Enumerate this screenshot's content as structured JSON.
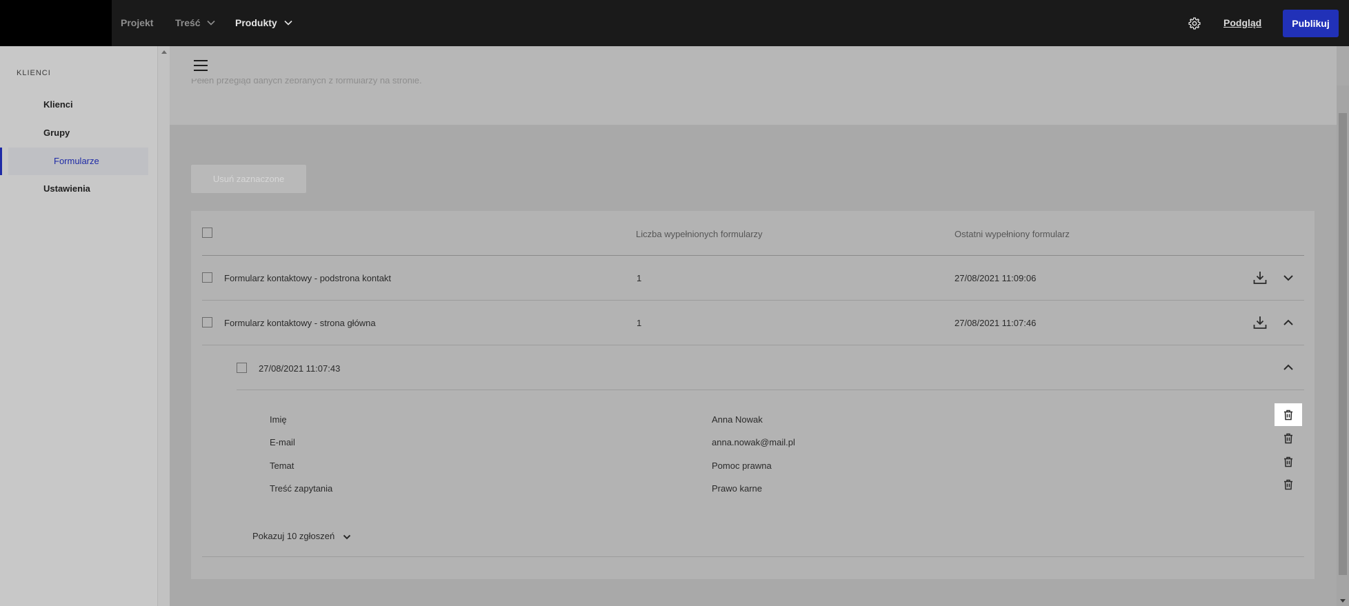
{
  "topbar": {
    "nav": [
      {
        "label": "Projekt",
        "has_dropdown": false,
        "active": false
      },
      {
        "label": "Treść",
        "has_dropdown": true,
        "active": false
      },
      {
        "label": "Produkty",
        "has_dropdown": true,
        "active": true
      }
    ],
    "settings_icon": "gear-icon",
    "preview_label": "Podgląd",
    "publish_label": "Publikuj",
    "publish_color": "#2131b8"
  },
  "sidebar": {
    "heading": "KLIENCI",
    "items": [
      {
        "label": "Klienci",
        "active": false
      },
      {
        "label": "Grupy",
        "active": false
      },
      {
        "label": "Formularze",
        "active": true
      },
      {
        "label": "Ustawienia",
        "active": false
      }
    ],
    "accent_color": "#1e2aa6"
  },
  "main": {
    "menu_icon": "hamburger-icon",
    "description": "Pełen przegląd danych zebranych z formularzy na stronie.",
    "delete_selected_label": "Usuń zaznaczone",
    "table": {
      "headers": [
        "",
        "Liczba wypełnionych formularzy",
        "Ostatni wypełniony formularz"
      ],
      "rows": [
        {
          "name": "Formularz kontaktowy - podstrona kontakt",
          "count": "1",
          "last": "27/08/2021 11:09:06",
          "expanded": false
        },
        {
          "name": "Formularz kontaktowy - strona główna",
          "count": "1",
          "last": "27/08/2021 11:07:46",
          "expanded": true
        }
      ],
      "submission": {
        "timestamp": "27/08/2021 11:07:43",
        "fields": [
          {
            "label": "Imię",
            "value": "Anna Nowak"
          },
          {
            "label": "E-mail",
            "value": "anna.nowak@mail.pl"
          },
          {
            "label": "Temat",
            "value": "Pomoc prawna"
          },
          {
            "label": "Treść zapytania",
            "value": "Prawo karne"
          }
        ]
      },
      "show_more_label": "Pokazuj 10 zgłoszeń"
    }
  }
}
